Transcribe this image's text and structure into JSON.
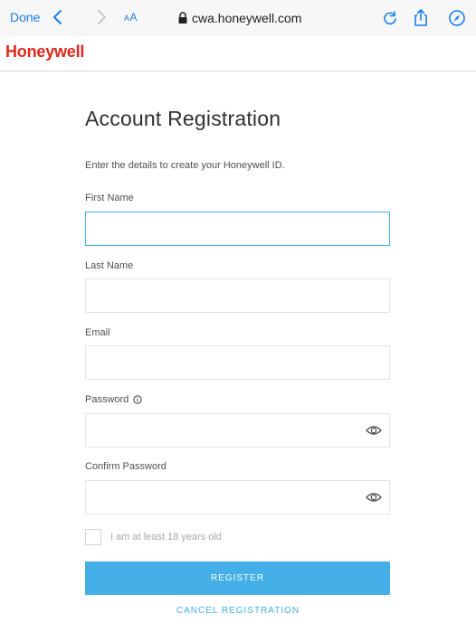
{
  "browser": {
    "done_label": "Done",
    "text_size_label_small": "A",
    "text_size_label_large": "A",
    "url": "cwa.honeywell.com",
    "accent_color": "#1a7ef0"
  },
  "brand": {
    "name": "Honeywell",
    "color": "#e1261c"
  },
  "form": {
    "title": "Account Registration",
    "subtitle": "Enter the details to create your Honeywell ID.",
    "fields": [
      {
        "label": "First Name",
        "value": "",
        "focused": true
      },
      {
        "label": "Last Name",
        "value": ""
      },
      {
        "label": "Email",
        "value": ""
      },
      {
        "label": "Password",
        "value": "",
        "icons": [
          "info-icon",
          "eye-icon"
        ]
      },
      {
        "label": "Confirm Password",
        "value": "",
        "icons": [
          "eye-icon"
        ]
      }
    ],
    "age_checkbox": {
      "label": "I am at least 18 years old",
      "checked": false
    },
    "register_label": "REGISTER",
    "cancel_label": "CANCEL REGISTRATION",
    "accent_color": "#45b0e8"
  }
}
